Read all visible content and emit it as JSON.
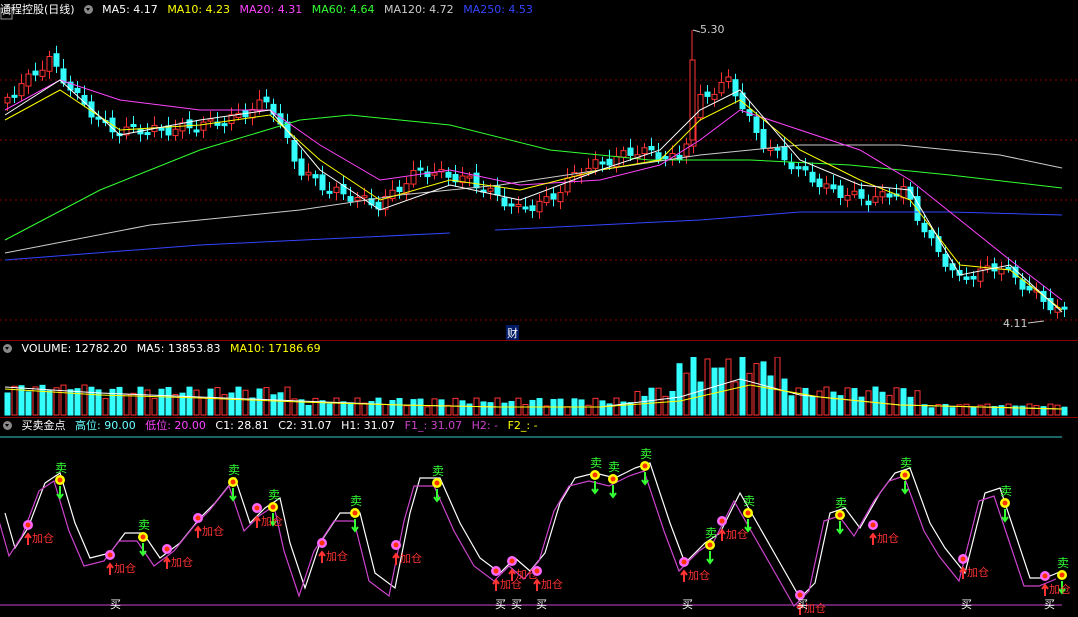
{
  "stock": {
    "name": "通程控股",
    "period": "(日线)"
  },
  "price_indicators": [
    {
      "label": "MA5: 4.17",
      "color": "#ffffff"
    },
    {
      "label": "MA10: 4.23",
      "color": "#ffff00"
    },
    {
      "label": "MA20: 4.31",
      "color": "#ff44ff"
    },
    {
      "label": "MA60: 4.64",
      "color": "#33ff33"
    },
    {
      "label": "MA120: 4.72",
      "color": "#cccccc"
    },
    {
      "label": "MA250: 4.53",
      "color": "#3344ff"
    }
  ],
  "price_high_label": "5.30",
  "price_low_label": "4.11",
  "finance_marker": "财",
  "volume_header": [
    {
      "label": "VOLUME: 12782.20",
      "color": "#ffffff"
    },
    {
      "label": "MA5: 13853.83",
      "color": "#ffffff"
    },
    {
      "label": "MA10: 17186.69",
      "color": "#ffff00"
    }
  ],
  "indicator_header": [
    {
      "label": "买卖金点",
      "color": "#ffffff"
    },
    {
      "label": "高位: 90.00",
      "color": "#66ffff"
    },
    {
      "label": "低位: 20.00",
      "color": "#ff44ff"
    },
    {
      "label": "C1: 28.81",
      "color": "#ffffff"
    },
    {
      "label": "C2: 31.07",
      "color": "#ffffff"
    },
    {
      "label": "H1: 31.07",
      "color": "#ffffff"
    },
    {
      "label": "F1_: 31.07",
      "color": "#cc44cc"
    },
    {
      "label": "H2: -",
      "color": "#cc44cc"
    },
    {
      "label": "F2_: -",
      "color": "#ffff00"
    }
  ],
  "signals": {
    "sell": "卖",
    "buy": "买",
    "add": "加仓"
  },
  "colors": {
    "up": "#ff3333",
    "down": "#33ffff",
    "grid": "#8b0000",
    "bg": "#000000"
  }
}
